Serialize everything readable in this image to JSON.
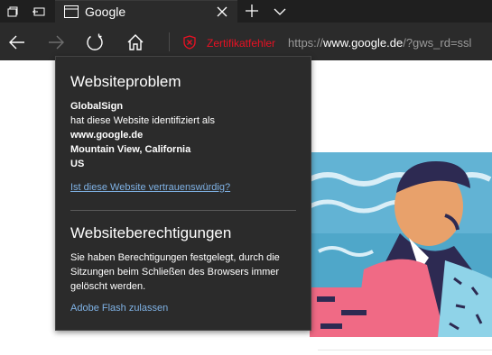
{
  "tab": {
    "title": "Google"
  },
  "cert": {
    "label": "Zertifikatfehler"
  },
  "address": {
    "scheme": "https://",
    "host": "www.google.de",
    "path": "/?gws_rd=ssl"
  },
  "flyout": {
    "problem_heading": "Websiteproblem",
    "issuer": "GlobalSign",
    "identified_text": "hat diese Website identifiziert als",
    "domain": "www.google.de",
    "location": "Mountain View, California",
    "country": "US",
    "trust_link": "Ist diese Website vertrauenswürdig?",
    "permissions_heading": "Websiteberechtigungen",
    "permissions_line1": "Sie haben Berechtigungen festgelegt, durch die",
    "permissions_line2": "Sitzungen beim Schließen des Browsers immer",
    "permissions_line3": "gelöscht werden.",
    "flash_link": "Adobe Flash zulassen"
  },
  "colors": {
    "error": "#e81123",
    "link": "#7fb2e5",
    "chrome_dark": "#2b2b2b",
    "tabstrip": "#1f1f1f"
  }
}
